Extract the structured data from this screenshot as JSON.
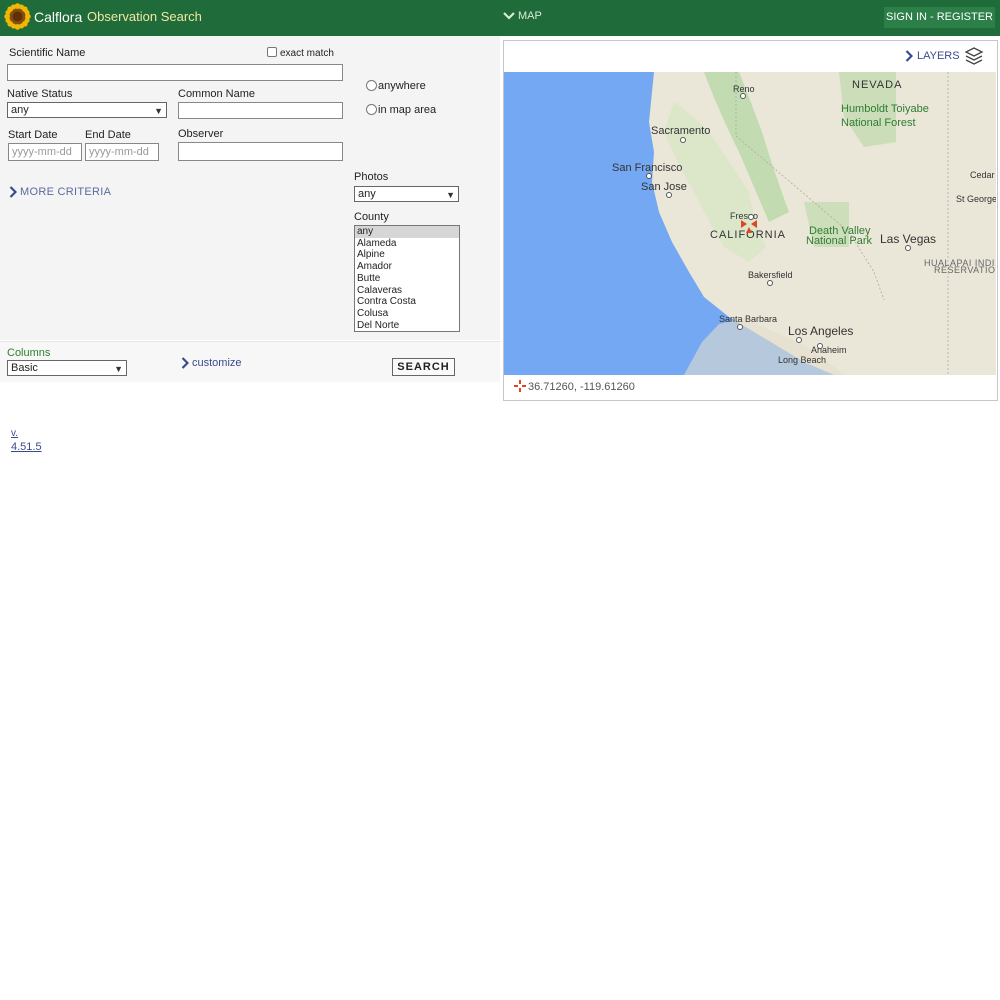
{
  "header": {
    "brand": "Calflora",
    "title": "Observation Search",
    "map_toggle": "MAP",
    "signin": "SIGN IN - REGISTER"
  },
  "form": {
    "scientific_name": {
      "label": "Scientific Name",
      "value": ""
    },
    "exact_match": {
      "label": "exact match",
      "checked": false
    },
    "native_status": {
      "label": "Native Status",
      "value": "any"
    },
    "common_name": {
      "label": "Common Name",
      "value": ""
    },
    "location": {
      "anywhere": "anywhere",
      "in_map_area": "in map area"
    },
    "start_date": {
      "label": "Start Date",
      "placeholder": "yyyy-mm-dd"
    },
    "end_date": {
      "label": "End Date",
      "placeholder": "yyyy-mm-dd"
    },
    "observer": {
      "label": "Observer",
      "value": ""
    },
    "more_criteria": "MORE CRITERIA",
    "photos": {
      "label": "Photos",
      "value": "any"
    },
    "county": {
      "label": "County",
      "options": [
        "any",
        "Alameda",
        "Alpine",
        "Amador",
        "Butte",
        "Calaveras",
        "Contra Costa",
        "Colusa",
        "Del Norte"
      ],
      "selected": "any"
    },
    "columns": {
      "label": "Columns",
      "value": "Basic"
    },
    "customize": "customize",
    "search_button": "SEARCH"
  },
  "map": {
    "layers_label": "LAYERS",
    "coordinates": "36.71260, -119.61260",
    "labels": {
      "nevada": "NEVADA",
      "reno": "Reno",
      "humboldt": "Humboldt Toiyabe",
      "national_forest": "National Forest",
      "sacramento": "Sacramento",
      "san_francisco": "San Francisco",
      "san_jose": "San Jose",
      "fresno": "Fresno",
      "california": "CALIFORNIA",
      "death_valley": "Death Valley",
      "national_park": "National Park",
      "las_vegas": "Las Vegas",
      "cedar_city": "Cedar Ci",
      "st_george": "St George",
      "hualapai": "HUALAPAI INDI",
      "reservation": "RESERVATIO",
      "bakersfield": "Bakersfield",
      "santa_barbara": "Santa Barbara",
      "los_angeles": "Los Angeles",
      "anaheim": "Anaheim",
      "long_beach": "Long Beach"
    },
    "colors": {
      "ocean": "#74a8f2",
      "land": "#eae6d8",
      "forest": "#b9d8a8",
      "marker": "#e0461f"
    }
  },
  "footer": {
    "version_prefix": "v.",
    "version": "4.51.5"
  }
}
